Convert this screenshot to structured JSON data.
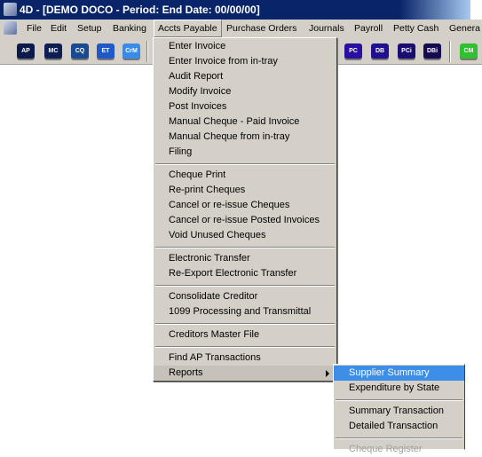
{
  "window": {
    "title": "4D - [DEMO DOCO  - Period:  End Date: 00/00/00]"
  },
  "menubar": [
    "File",
    "Edit",
    "Setup",
    "Banking",
    "Accts Payable",
    "Purchase Orders",
    "Journals",
    "Payroll",
    "Petty Cash",
    "Genera"
  ],
  "toolbar": [
    {
      "label": "AP",
      "color": "#0b1a4a"
    },
    {
      "label": "MC",
      "color": "#0e1e52"
    },
    {
      "label": "CQ",
      "color": "#1a4a90"
    },
    {
      "label": "ET",
      "color": "#2058c8"
    },
    {
      "label": "CrM",
      "color": "#3a8ae8"
    },
    {
      "label": "PC",
      "color": "#2a10a0"
    },
    {
      "label": "DB",
      "color": "#201090"
    },
    {
      "label": "PCi",
      "color": "#1a0c70"
    },
    {
      "label": "DBi",
      "color": "#140a50"
    },
    {
      "label": "CM",
      "color": "#30c030"
    }
  ],
  "menu": {
    "groups": [
      [
        "Enter Invoice",
        "Enter Invoice from in-tray",
        "Audit Report",
        "Modify Invoice",
        "Post Invoices",
        "Manual Cheque - Paid Invoice",
        "Manual Cheque from in-tray",
        "Filing"
      ],
      [
        "Cheque Print",
        "Re-print Cheques",
        "Cancel or re-issue Cheques",
        "Cancel or re-issue Posted Invoices",
        "Void Unused Cheques"
      ],
      [
        "Electronic Transfer",
        "Re-Export Electronic Transfer"
      ],
      [
        "Consolidate Creditor",
        "1099 Processing and Transmittal"
      ],
      [
        "Creditors Master File"
      ],
      [
        "Find AP Transactions",
        "Reports"
      ]
    ]
  },
  "submenu": {
    "groups": [
      [
        "Supplier Summary",
        "Expenditure by State"
      ],
      [
        "Summary Transaction",
        "Detailed Transaction"
      ],
      [
        "Cheque Register"
      ]
    ],
    "selected": "Supplier Summary"
  }
}
